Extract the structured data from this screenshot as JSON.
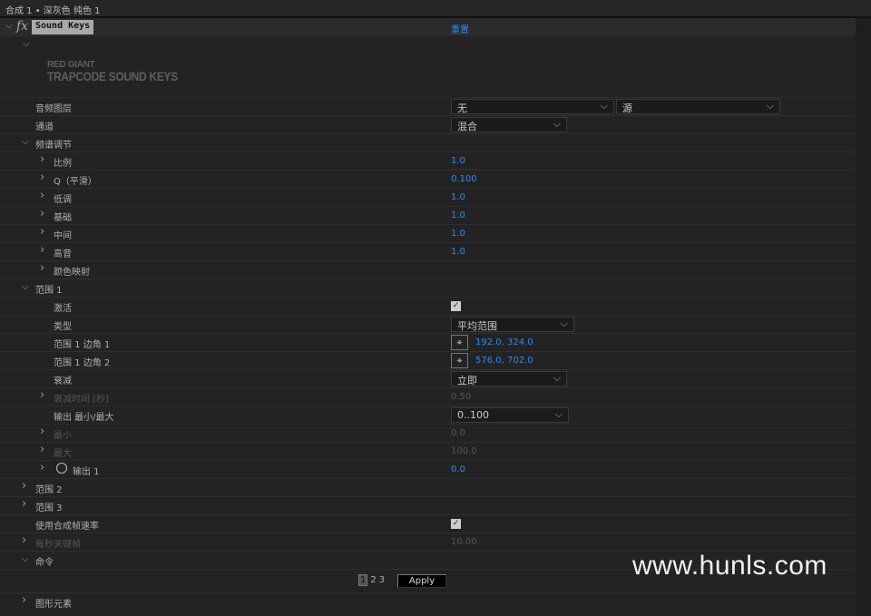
{
  "topbar": {
    "title": "合成 1 • 深灰色 纯色 1"
  },
  "effect": {
    "name": "Sound Keys",
    "reset": "重置",
    "logo_line1": "RED GIANT",
    "logo_line2": "TRAPCODE SOUND KEYS"
  },
  "rows": [
    {
      "label": "音频图层",
      "level": 0,
      "tw": "",
      "kind": "dd2",
      "v1": "无",
      "v2": "源"
    },
    {
      "label": "通道",
      "level": 0,
      "tw": "",
      "kind": "dd",
      "v1": "混合",
      "w": 128
    },
    {
      "label": "频谱调节",
      "level": 0,
      "tw": "open"
    },
    {
      "label": "比例",
      "level": 1,
      "tw": "closed",
      "kind": "num",
      "v1": "1.0"
    },
    {
      "label": "Q（平滑）",
      "level": 1,
      "tw": "closed",
      "kind": "num",
      "v1": "0.100"
    },
    {
      "label": "低调",
      "level": 1,
      "tw": "closed",
      "kind": "num",
      "v1": "1.0"
    },
    {
      "label": "基础",
      "level": 1,
      "tw": "closed",
      "kind": "num",
      "v1": "1.0"
    },
    {
      "label": "中间",
      "level": 1,
      "tw": "closed",
      "kind": "num",
      "v1": "1.0"
    },
    {
      "label": "高音",
      "level": 1,
      "tw": "closed",
      "kind": "num",
      "v1": "1.0"
    },
    {
      "label": "颜色映射",
      "level": 1,
      "tw": "closed"
    },
    {
      "label": "范围 1",
      "level": 0,
      "tw": "open"
    },
    {
      "label": "激活",
      "level": 1,
      "tw": "",
      "kind": "check"
    },
    {
      "label": "类型",
      "level": 1,
      "tw": "",
      "kind": "dd",
      "v1": "平均范围",
      "w": 136
    },
    {
      "label": "范围 1 边角 1",
      "level": 1,
      "tw": "",
      "kind": "point",
      "v1": "192.0, 324.0"
    },
    {
      "label": "范围 1 边角 2",
      "level": 1,
      "tw": "",
      "kind": "point",
      "v1": "576.0, 702.0"
    },
    {
      "label": "衰减",
      "level": 1,
      "tw": "",
      "kind": "dd",
      "v1": "立即",
      "w": 128
    },
    {
      "label": "衰减时间 [秒]",
      "level": 1,
      "tw": "closed",
      "kind": "num",
      "v1": "0.50",
      "dim": true
    },
    {
      "label": "输出 最小/最大",
      "level": 1,
      "tw": "",
      "kind": "dd",
      "v1": "0..100",
      "w": 130
    },
    {
      "label": "最小",
      "level": 1,
      "tw": "closed",
      "kind": "num",
      "v1": "0.0",
      "dim": true
    },
    {
      "label": "最大",
      "level": 1,
      "tw": "closed",
      "kind": "num",
      "v1": "100.0",
      "dim": true
    },
    {
      "label": "输出 1",
      "level": 1,
      "tw": "closed",
      "kind": "num",
      "v1": "0.0",
      "stopwatch": true
    },
    {
      "label": "范围 2",
      "level": 0,
      "tw": "closed"
    },
    {
      "label": "范围 3",
      "level": 0,
      "tw": "closed"
    },
    {
      "label": "使用合成帧速率",
      "level": 0,
      "tw": "",
      "kind": "check"
    },
    {
      "label": "每秒关键帧",
      "level": 0,
      "tw": "closed",
      "kind": "num",
      "v1": "10.00",
      "dim": true
    },
    {
      "label": "命令",
      "level": 0,
      "tw": "open"
    },
    {
      "label": "",
      "level": 0,
      "tw": "",
      "kind": "cmd"
    },
    {
      "label": "图形元素",
      "level": 0,
      "tw": "closed"
    }
  ],
  "command": {
    "pages": [
      "1",
      "2",
      "3"
    ],
    "apply": "Apply"
  },
  "watermark": "www.hunls.com"
}
